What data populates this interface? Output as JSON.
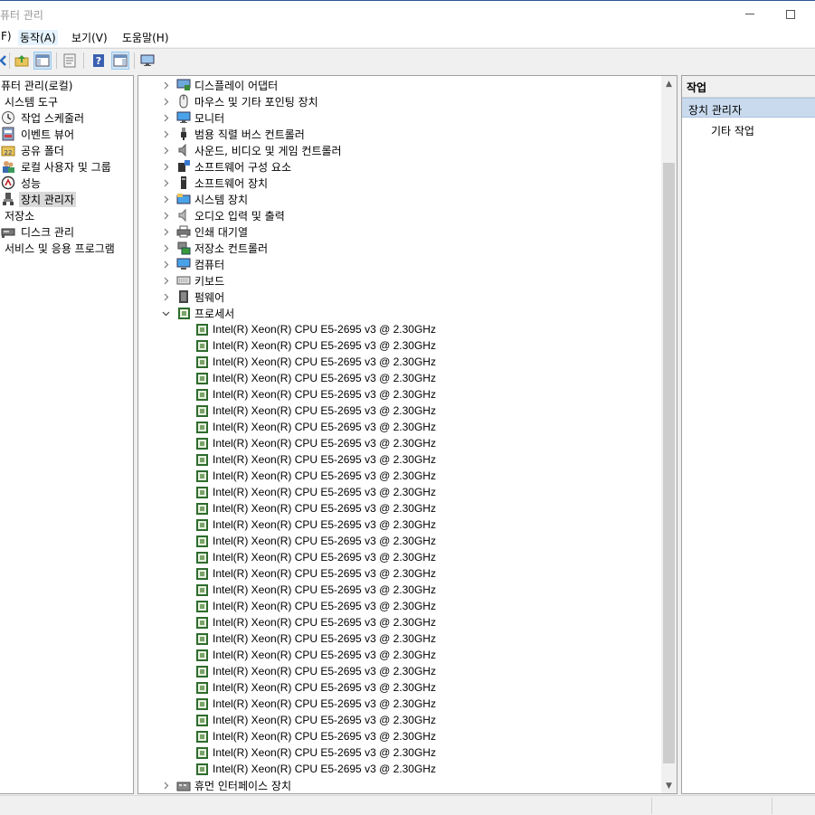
{
  "window": {
    "title": "퓨터 관리"
  },
  "menu": {
    "items": [
      "F)",
      "동작(A)",
      "보기(V)",
      "도움말(H)"
    ]
  },
  "toolbar": {
    "icons": [
      "back-arrow-icon",
      "folder-up-icon",
      "show-hide-tree-icon",
      "properties-icon",
      "help-icon",
      "show-action-pane-icon",
      "monitor-icon"
    ]
  },
  "left_tree": {
    "items": [
      {
        "label": "퓨터 관리(로컬)",
        "icon": "computer-management-icon"
      },
      {
        "label": "시스템 도구",
        "icon": "tools-icon"
      },
      {
        "label": "작업 스케줄러",
        "icon": "clock-icon"
      },
      {
        "label": "이벤트 뷰어",
        "icon": "event-viewer-icon"
      },
      {
        "label": "공유 폴더",
        "icon": "shared-folder-icon"
      },
      {
        "label": "로컬 사용자 및 그룹",
        "icon": "users-icon"
      },
      {
        "label": "성능",
        "icon": "performance-icon"
      },
      {
        "label": "장치 관리자",
        "icon": "device-manager-icon"
      },
      {
        "label": "저장소",
        "icon": "storage-icon"
      },
      {
        "label": "디스크 관리",
        "icon": "disk-icon"
      },
      {
        "label": "서비스 및 응용 프로그램",
        "icon": "services-icon"
      }
    ]
  },
  "device_tree": {
    "categories_before": [
      {
        "label": "디스플레이 어댑터",
        "icon": "display-adapter-icon"
      },
      {
        "label": "마우스 및 기타 포인팅 장치",
        "icon": "mouse-icon"
      },
      {
        "label": "모니터",
        "icon": "monitor-icon"
      },
      {
        "label": "범용 직렬 버스 컨트롤러",
        "icon": "usb-icon"
      },
      {
        "label": "사운드, 비디오 및 게임 컨트롤러",
        "icon": "speaker-icon"
      },
      {
        "label": "소프트웨어 구성 요소",
        "icon": "software-component-icon"
      },
      {
        "label": "소프트웨어 장치",
        "icon": "software-device-icon"
      },
      {
        "label": "시스템 장치",
        "icon": "system-device-icon"
      },
      {
        "label": "오디오 입력 및 출력",
        "icon": "audio-icon"
      },
      {
        "label": "인쇄 대기열",
        "icon": "printer-icon"
      },
      {
        "label": "저장소 컨트롤러",
        "icon": "storage-controller-icon"
      },
      {
        "label": "컴퓨터",
        "icon": "computer-icon"
      },
      {
        "label": "키보드",
        "icon": "keyboard-icon"
      },
      {
        "label": "펌웨어",
        "icon": "firmware-icon"
      }
    ],
    "expanded_category": {
      "label": "프로세서",
      "icon": "processor-icon"
    },
    "processors": [
      "Intel(R) Xeon(R) CPU E5-2695 v3 @ 2.30GHz",
      "Intel(R) Xeon(R) CPU E5-2695 v3 @ 2.30GHz",
      "Intel(R) Xeon(R) CPU E5-2695 v3 @ 2.30GHz",
      "Intel(R) Xeon(R) CPU E5-2695 v3 @ 2.30GHz",
      "Intel(R) Xeon(R) CPU E5-2695 v3 @ 2.30GHz",
      "Intel(R) Xeon(R) CPU E5-2695 v3 @ 2.30GHz",
      "Intel(R) Xeon(R) CPU E5-2695 v3 @ 2.30GHz",
      "Intel(R) Xeon(R) CPU E5-2695 v3 @ 2.30GHz",
      "Intel(R) Xeon(R) CPU E5-2695 v3 @ 2.30GHz",
      "Intel(R) Xeon(R) CPU E5-2695 v3 @ 2.30GHz",
      "Intel(R) Xeon(R) CPU E5-2695 v3 @ 2.30GHz",
      "Intel(R) Xeon(R) CPU E5-2695 v3 @ 2.30GHz",
      "Intel(R) Xeon(R) CPU E5-2695 v3 @ 2.30GHz",
      "Intel(R) Xeon(R) CPU E5-2695 v3 @ 2.30GHz",
      "Intel(R) Xeon(R) CPU E5-2695 v3 @ 2.30GHz",
      "Intel(R) Xeon(R) CPU E5-2695 v3 @ 2.30GHz",
      "Intel(R) Xeon(R) CPU E5-2695 v3 @ 2.30GHz",
      "Intel(R) Xeon(R) CPU E5-2695 v3 @ 2.30GHz",
      "Intel(R) Xeon(R) CPU E5-2695 v3 @ 2.30GHz",
      "Intel(R) Xeon(R) CPU E5-2695 v3 @ 2.30GHz",
      "Intel(R) Xeon(R) CPU E5-2695 v3 @ 2.30GHz",
      "Intel(R) Xeon(R) CPU E5-2695 v3 @ 2.30GHz",
      "Intel(R) Xeon(R) CPU E5-2695 v3 @ 2.30GHz",
      "Intel(R) Xeon(R) CPU E5-2695 v3 @ 2.30GHz",
      "Intel(R) Xeon(R) CPU E5-2695 v3 @ 2.30GHz",
      "Intel(R) Xeon(R) CPU E5-2695 v3 @ 2.30GHz",
      "Intel(R) Xeon(R) CPU E5-2695 v3 @ 2.30GHz",
      "Intel(R) Xeon(R) CPU E5-2695 v3 @ 2.30GHz"
    ],
    "categories_after": [
      {
        "label": "휴먼 인터페이스 장치",
        "icon": "hid-icon"
      }
    ]
  },
  "action_pane": {
    "header": "작업",
    "section": "장치 관리자",
    "actions": [
      "기타 작업"
    ]
  },
  "colors": {
    "title_border": "#2b5797",
    "selection_gray": "#d9d9d9",
    "action_section_bg": "#c9daee",
    "chip_green": "#2e6b2e"
  }
}
